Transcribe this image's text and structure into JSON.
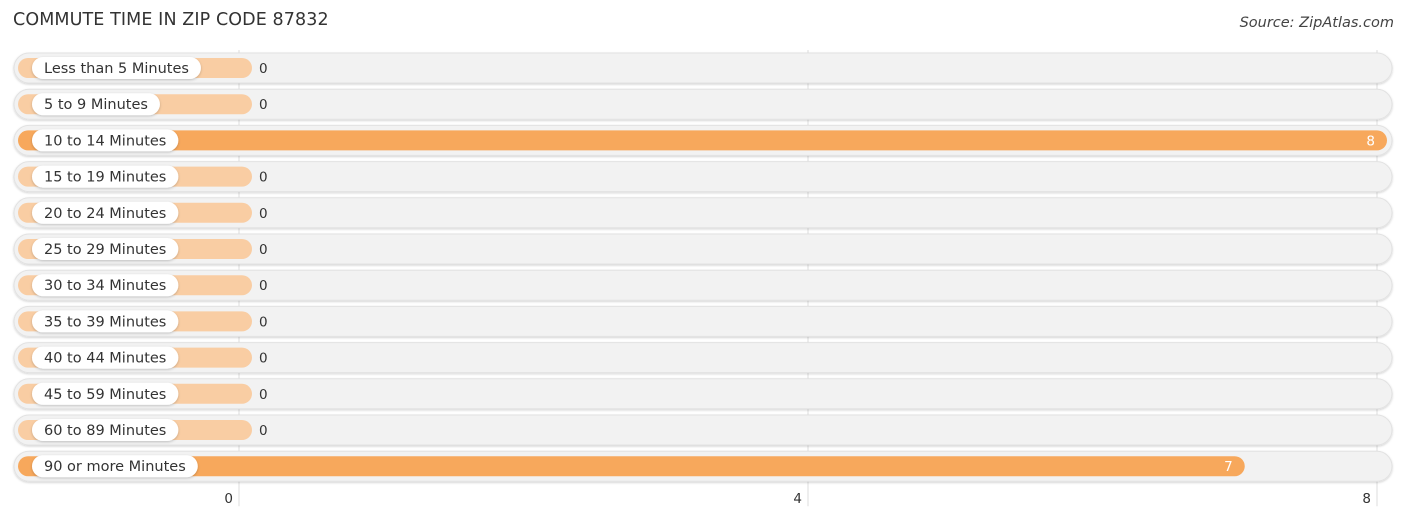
{
  "chart_data": {
    "type": "bar",
    "orientation": "horizontal",
    "title": "COMMUTE TIME IN ZIP CODE 87832",
    "source": "Source: ZipAtlas.com",
    "categories": [
      "Less than 5 Minutes",
      "5 to 9 Minutes",
      "10 to 14 Minutes",
      "15 to 19 Minutes",
      "20 to 24 Minutes",
      "25 to 29 Minutes",
      "30 to 34 Minutes",
      "35 to 39 Minutes",
      "40 to 44 Minutes",
      "45 to 59 Minutes",
      "60 to 89 Minutes",
      "90 or more Minutes"
    ],
    "values": [
      0,
      0,
      8,
      0,
      0,
      0,
      0,
      0,
      0,
      0,
      0,
      7
    ],
    "xlabel": "",
    "ylabel": "",
    "xlim": [
      0,
      8
    ],
    "xticks": [
      0,
      4,
      8
    ],
    "grid": true,
    "legend": "none",
    "colors": {
      "bar": "#f7a85c",
      "bar_zero": "#f9cda3",
      "track": "#f2f2f2",
      "gridline": "#dddddd",
      "label_bg": "#ffffff"
    }
  }
}
